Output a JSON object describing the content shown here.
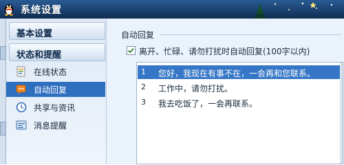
{
  "window": {
    "title": "系统设置"
  },
  "sidebar": {
    "sections": [
      {
        "label": "基本设置"
      },
      {
        "label": "状态和提醒"
      }
    ],
    "items": [
      {
        "label": "在线状态",
        "icon": "online-status-icon"
      },
      {
        "label": "自动回复",
        "icon": "auto-reply-icon",
        "selected": true
      },
      {
        "label": "共享与资讯",
        "icon": "clock-icon"
      },
      {
        "label": "消息提醒",
        "icon": "message-alert-icon"
      }
    ]
  },
  "main": {
    "group_title": "自动回复",
    "checkbox": {
      "label": "离开、忙碌、请勿打扰时自动回复(100字以内)",
      "checked": true
    },
    "replies": [
      {
        "num": "1",
        "text": "您好，我现在有事不在，一会再和您联系。",
        "selected": true
      },
      {
        "num": "2",
        "text": "工作中，请勿打扰。"
      },
      {
        "num": "3",
        "text": "我去吃饭了，一会再联系。"
      }
    ]
  },
  "colors": {
    "titlebar": "#1d4677",
    "selection": "#3576c6",
    "panel_bg": "#eaf2fb"
  }
}
